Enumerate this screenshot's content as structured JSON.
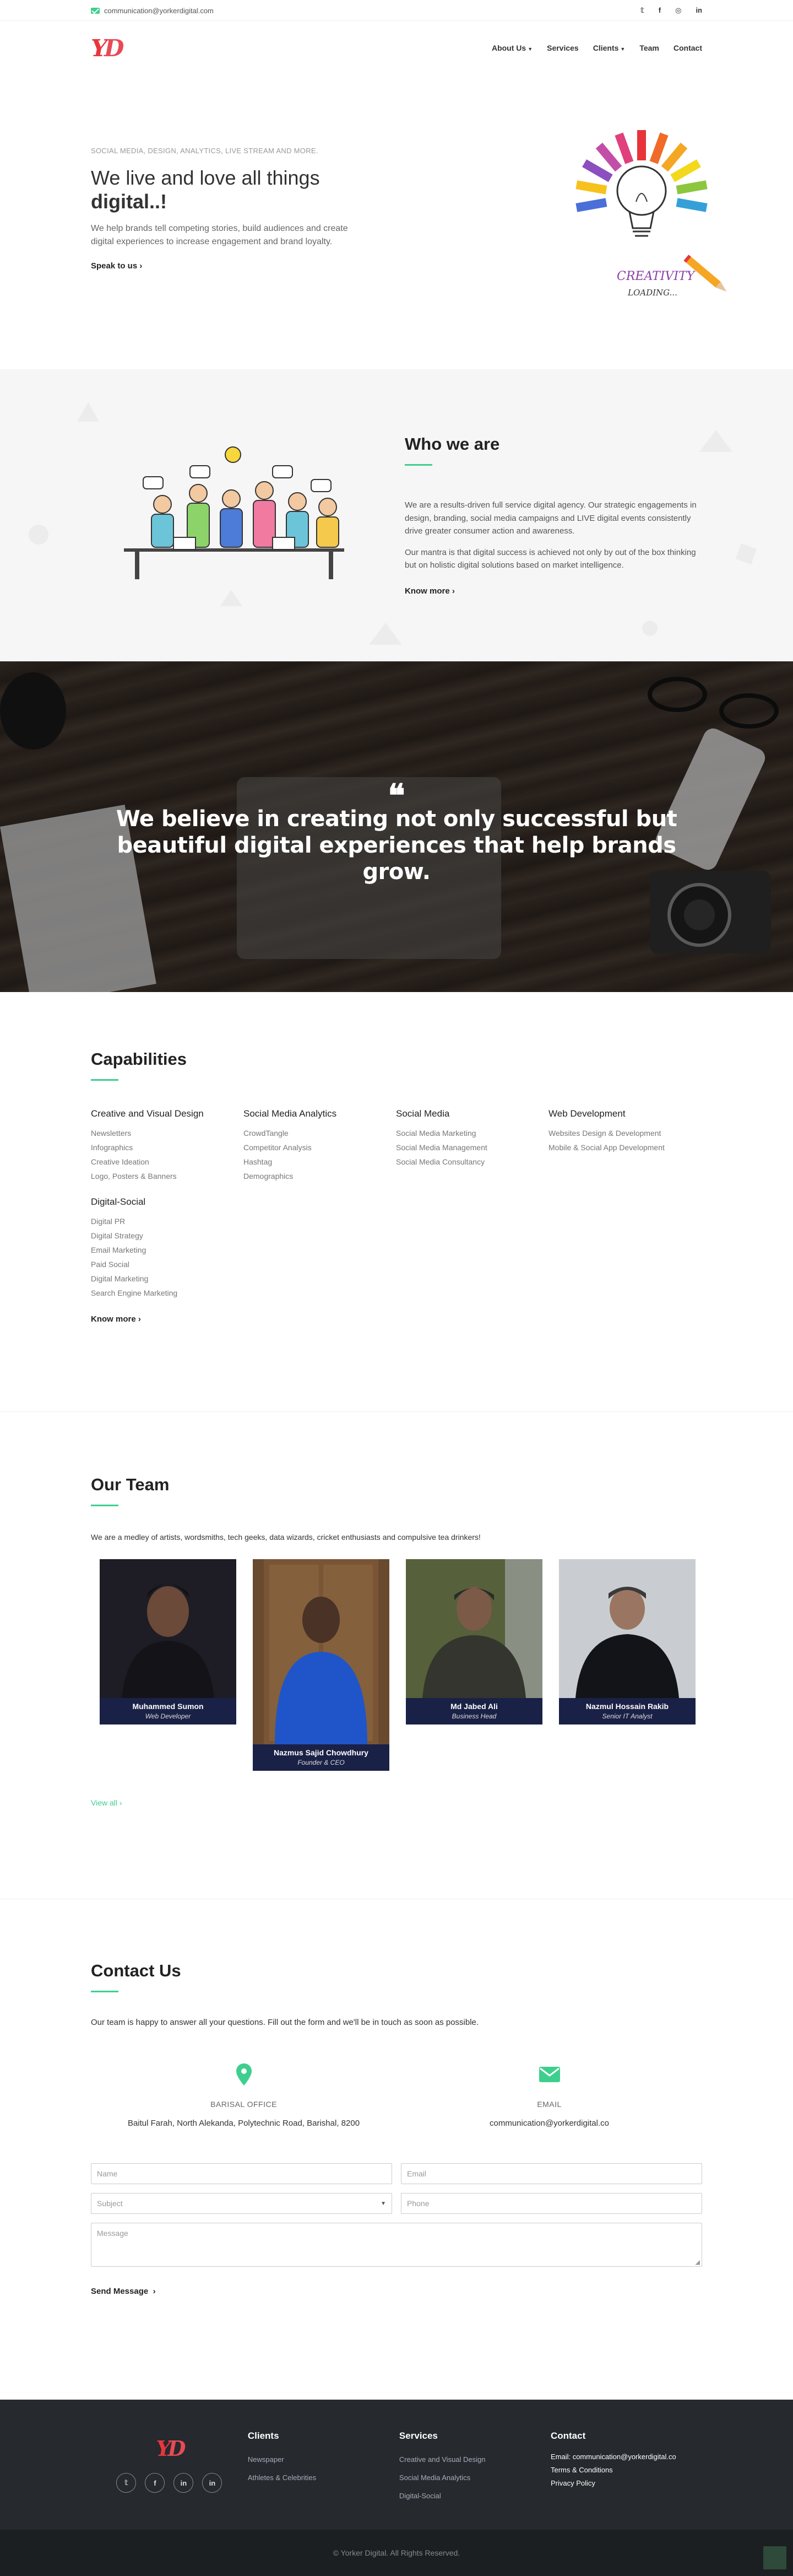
{
  "topbar": {
    "email": "communication@yorkerdigital.com",
    "socials": [
      "twitter-icon",
      "facebook-icon",
      "instagram-icon",
      "linkedin-icon"
    ],
    "social_glyphs": [
      "𝕥",
      "f",
      "◎",
      "in"
    ]
  },
  "nav": {
    "logo": "YD",
    "items": [
      {
        "label": "About Us",
        "has_caret": true
      },
      {
        "label": "Services",
        "has_caret": false
      },
      {
        "label": "Clients",
        "has_caret": true
      },
      {
        "label": "Team",
        "has_caret": false
      },
      {
        "label": "Contact",
        "has_caret": false
      }
    ]
  },
  "hero": {
    "eyebrow": "SOCIAL MEDIA, DESIGN, ANALYTICS, LIVE STREAM AND MORE.",
    "title_line1": "We live and love all things",
    "title_line2": "digital..!",
    "desc": "We help brands tell competing stories, build audiences and create digital experiences to increase engagement and brand loyalty.",
    "cta": "Speak to us",
    "image_text1": "CREATIVITY",
    "image_text2": "LOADING..."
  },
  "who": {
    "title": "Who we are",
    "p1": "We are a results-driven full service digital agency. Our strategic engagements in design, branding, social media campaigns and LIVE digital events consistently drive greater consumer action and awareness.",
    "p2": "Our mantra is that digital success is achieved not only by out of the box thinking but on holistic digital solutions based on market intelligence.",
    "cta": "Know more"
  },
  "banner": {
    "quote_mark": "❝",
    "text": "We believe in creating not only successful but beautiful digital experiences that help brands grow."
  },
  "capabilities": {
    "title": "Capabilities",
    "groups": [
      {
        "title": "Creative and Visual Design",
        "items": [
          "Newsletters",
          "Infographics",
          "Creative Ideation",
          "Logo, Posters & Banners"
        ]
      },
      {
        "title": "Social Media Analytics",
        "items": [
          "CrowdTangle",
          "Competitor Analysis",
          "Hashtag",
          "Demographics"
        ]
      },
      {
        "title": "Social Media",
        "items": [
          "Social Media Marketing",
          "Social Media Management",
          "Social Media Consultancy"
        ]
      },
      {
        "title": "Web Development",
        "items": [
          "Websites Design & Development",
          "Mobile & Social App Development"
        ]
      },
      {
        "title": "Digital-Social",
        "items": [
          "Digital PR",
          "Digital Strategy",
          "Email Marketing",
          "Paid Social",
          "Digital Marketing",
          "Search Engine Marketing"
        ]
      }
    ],
    "cta": "Know more"
  },
  "team": {
    "title": "Our Team",
    "intro": "We are a medley of artists, wordsmiths, tech geeks, data wizards, cricket enthusiasts and compulsive tea drinkers!",
    "members": [
      {
        "name": "Muhammed Sumon",
        "role": "Web Developer"
      },
      {
        "name": "Nazmus Sajid Chowdhury",
        "role": "Founder & CEO"
      },
      {
        "name": "Md Jabed Ali",
        "role": "Business Head"
      },
      {
        "name": "Nazmul Hossain Rakib",
        "role": "Senior IT Analyst"
      }
    ],
    "view_all": "View all"
  },
  "contact": {
    "title": "Contact Us",
    "intro": "Our team is happy to answer all your questions. Fill out the form and we'll be in touch as soon as possible.",
    "office_label": "BARISAL OFFICE",
    "office_address": "Baitul Farah, North Alekanda, Polytechnic Road, Barishal, 8200",
    "email_label": "EMAIL",
    "email_value": "communication@yorkerdigital.co",
    "form": {
      "name_ph": "Name",
      "email_ph": "Email",
      "subject": "Subject",
      "phone_ph": "Phone",
      "message_ph": "Message",
      "send": "Send Message"
    }
  },
  "footer": {
    "logo": "YD",
    "socials": [
      "twitter-icon",
      "facebook-icon",
      "linkedin-icon",
      "linkedin-icon"
    ],
    "social_glyphs": [
      "𝕥",
      "f",
      "in",
      "in"
    ],
    "clients_title": "Clients",
    "clients_items": [
      "Newspaper",
      "Athletes & Celebrities"
    ],
    "services_title": "Services",
    "services_items": [
      "Creative and Visual Design",
      "Social Media Analytics",
      "Digital-Social"
    ],
    "contact_title": "Contact",
    "contact_items": [
      "Email: communication@yorkerdigital.co",
      "Terms & Conditions",
      "Privacy Policy"
    ],
    "copyright": "© Yorker Digital. All Rights Reserved."
  },
  "colors": {
    "accent": "#3ecf8e",
    "brand_red": "#e8363c",
    "navy": "#1a2146",
    "footer_bg": "#26292d"
  }
}
